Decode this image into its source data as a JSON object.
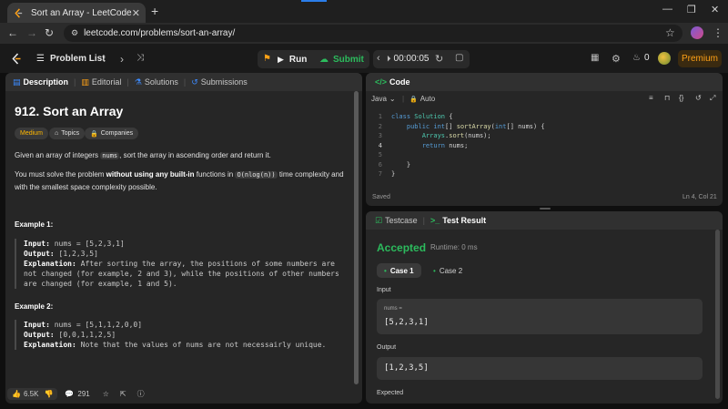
{
  "browser": {
    "tab_title": "Sort an Array - LeetCode",
    "url": "leetcode.com/problems/sort-an-array/"
  },
  "header": {
    "problem_list": "Problem List",
    "run": "Run",
    "submit": "Submit",
    "timer": "00:00:05",
    "streak": "0",
    "premium": "Premium"
  },
  "left_tabs": {
    "description": "Description",
    "editorial": "Editorial",
    "solutions": "Solutions",
    "submissions": "Submissions"
  },
  "problem": {
    "title": "912. Sort an Array",
    "difficulty": "Medium",
    "topics": "Topics",
    "companies": "Companies",
    "desc1_pre": "Given an array of integers ",
    "desc1_code": "nums",
    "desc1_post": ", sort the array in ascending order and return it.",
    "desc2_pre": "You must solve the problem ",
    "desc2_bold": "without using any built-in",
    "desc2_mid": " functions in ",
    "desc2_code": "O(nlog(n))",
    "desc2_post": " time complexity and with the smallest space complexity possible."
  },
  "examples": [
    {
      "heading": "Example 1:",
      "input_label": "Input:",
      "input": "nums = [5,2,3,1]",
      "output_label": "Output:",
      "output": "[1,2,3,5]",
      "explanation_label": "Explanation:",
      "explanation": "After sorting the array, the positions of some numbers are not changed (for example, 2 and 3), while the positions of other numbers are changed (for example, 1 and 5)."
    },
    {
      "heading": "Example 2:",
      "input_label": "Input:",
      "input": "nums = [5,1,1,2,0,0]",
      "output_label": "Output:",
      "output": "[0,0,1,1,2,5]",
      "explanation_label": "Explanation:",
      "explanation": "Note that the values of nums are not necessairly unique."
    }
  ],
  "footer": {
    "likes": "6.5K",
    "comments": "291"
  },
  "code_panel": {
    "title": "Code",
    "language": "Java",
    "mode": "Auto",
    "saved": "Saved",
    "cursor": "Ln 4, Col 21",
    "lines": [
      {
        "n": "1",
        "text": "class Solution {"
      },
      {
        "n": "2",
        "text": "    public int[] sortArray(int[] nums) {"
      },
      {
        "n": "3",
        "text": "        Arrays.sort(nums);"
      },
      {
        "n": "4",
        "text": "        return nums;"
      },
      {
        "n": "5",
        "text": ""
      },
      {
        "n": "6",
        "text": "    }"
      },
      {
        "n": "7",
        "text": "}"
      }
    ]
  },
  "result_panel": {
    "testcase_tab": "Testcase",
    "result_tab": "Test Result",
    "status": "Accepted",
    "runtime": "Runtime: 0 ms",
    "case1": "Case 1",
    "case2": "Case 2",
    "input_label": "Input",
    "var_label": "nums =",
    "input_value": "[5,2,3,1]",
    "output_label": "Output",
    "output_value": "[1,2,3,5]",
    "expected_label": "Expected"
  },
  "colors": {
    "accent_green": "#2cbb5d",
    "brand_orange": "#ffa116",
    "medium_badge": "#ffb800"
  }
}
